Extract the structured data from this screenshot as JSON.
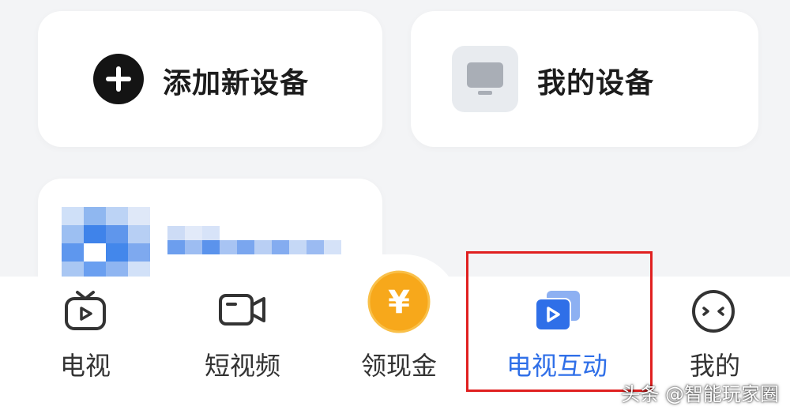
{
  "cards": {
    "add_device": {
      "label": "添加新设备",
      "icon": "plus-circle-icon"
    },
    "my_devices": {
      "label": "我的设备",
      "icon": "tv-icon"
    }
  },
  "bottom_nav": {
    "items": [
      {
        "label": "电视",
        "icon": "tv-icon",
        "active": false
      },
      {
        "label": "短视频",
        "icon": "video-camera-icon",
        "active": false
      },
      {
        "label": "领现金",
        "icon": "yuan-coin-icon",
        "active": false
      },
      {
        "label": "电视互动",
        "icon": "screen-cast-icon",
        "active": true
      },
      {
        "label": "我的",
        "icon": "face-icon",
        "active": false
      }
    ],
    "coin_symbol": "¥"
  },
  "watermark": "头条 @智能玩家圈",
  "colors": {
    "accent": "#2f6fe8",
    "coin": "#f7a81b",
    "highlight": "#e02020",
    "background": "#f3f4f6"
  }
}
